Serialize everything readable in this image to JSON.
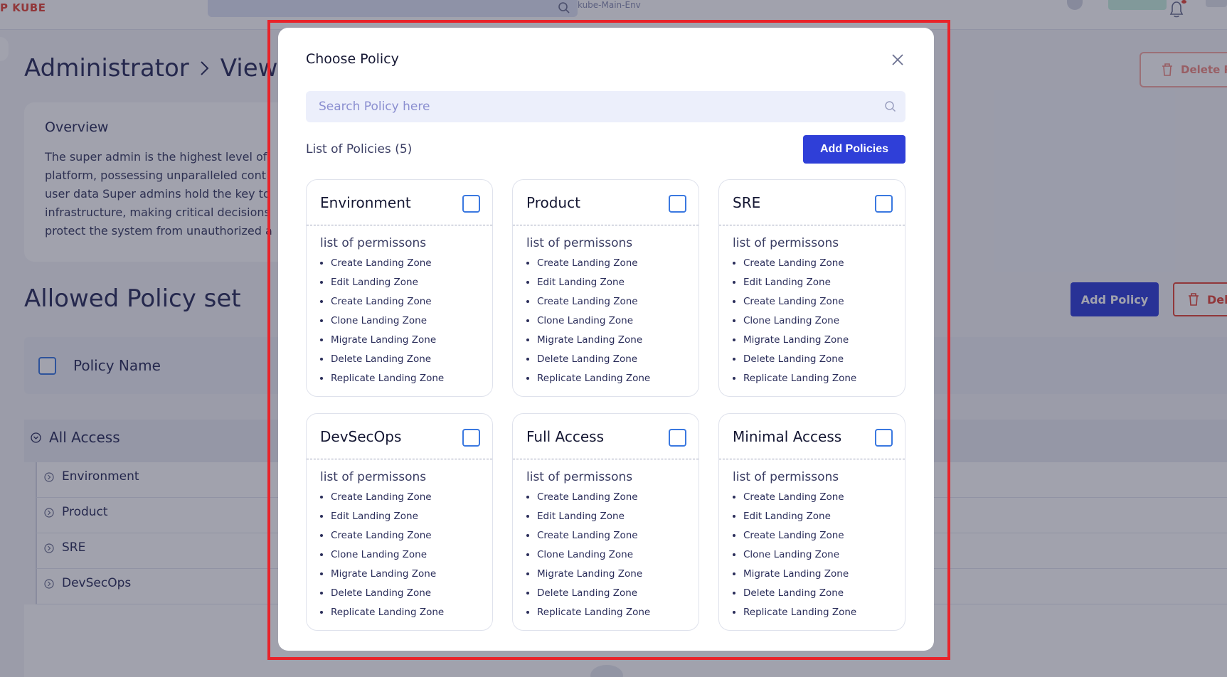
{
  "app": {
    "logo": "P KUBE",
    "environment": "kube-Main-Env"
  },
  "page": {
    "breadcrumb": [
      "Administrator",
      "View"
    ],
    "delete_role_label": "Delete R",
    "overview": {
      "title": "Overview",
      "text": "The super admin is the highest level of\nplatform, possessing unparalleled cont\nuser data Super admins hold the key to\ninfrastructure, making critical decisions\nprotect the system from unauthorized a"
    },
    "policy_set_title": "Allowed Policy set",
    "add_policy_label": "Add Policy",
    "delete_label": "Del",
    "table": {
      "column_header": "Policy Name",
      "group": "All Access",
      "rows": [
        "Environment",
        "Product",
        "SRE",
        "DevSecOps"
      ]
    }
  },
  "modal": {
    "title": "Choose Policy",
    "search_placeholder": "Search Policy here",
    "list_count": "List of Policies (5)",
    "add_policies_label": "Add Policies",
    "permissions_heading": "list of permissons",
    "cards": [
      {
        "name": "Environment",
        "checked": false,
        "permissions": [
          "Create Landing Zone",
          "Edit Landing Zone",
          "Create Landing Zone",
          "Clone Landing Zone",
          "Migrate Landing Zone",
          "Delete Landing Zone",
          "Replicate Landing Zone"
        ]
      },
      {
        "name": "Product",
        "checked": false,
        "permissions": [
          "Create Landing Zone",
          "Edit Landing Zone",
          "Create Landing Zone",
          "Clone Landing Zone",
          "Migrate Landing Zone",
          "Delete Landing Zone",
          "Replicate Landing Zone"
        ]
      },
      {
        "name": "SRE",
        "checked": false,
        "permissions": [
          "Create Landing Zone",
          "Edit Landing Zone",
          "Create Landing Zone",
          "Clone Landing Zone",
          "Migrate Landing Zone",
          "Delete Landing Zone",
          "Replicate Landing Zone"
        ]
      },
      {
        "name": "DevSecOps",
        "checked": false,
        "permissions": [
          "Create Landing Zone",
          "Edit Landing Zone",
          "Create Landing Zone",
          "Clone Landing Zone",
          "Migrate Landing Zone",
          "Delete Landing Zone",
          "Replicate Landing Zone"
        ]
      },
      {
        "name": "Full Access",
        "checked": false,
        "permissions": [
          "Create Landing Zone",
          "Edit Landing Zone",
          "Create Landing Zone",
          "Clone Landing Zone",
          "Migrate Landing Zone",
          "Delete Landing Zone",
          "Replicate Landing Zone"
        ]
      },
      {
        "name": "Minimal Access",
        "checked": false,
        "permissions": [
          "Create Landing Zone",
          "Edit Landing Zone",
          "Create Landing Zone",
          "Clone Landing Zone",
          "Migrate Landing Zone",
          "Delete Landing Zone",
          "Replicate Landing Zone"
        ]
      }
    ]
  },
  "icons": {
    "search": "search-icon",
    "close": "close-icon",
    "bell": "bell-icon",
    "trash": "trash-icon",
    "expand": "chevron-circle-icon"
  },
  "colors": {
    "primary": "#2f3fd8",
    "danger": "#e4473a",
    "checkbox": "#3a78e0",
    "highlight": "#e8232a"
  }
}
